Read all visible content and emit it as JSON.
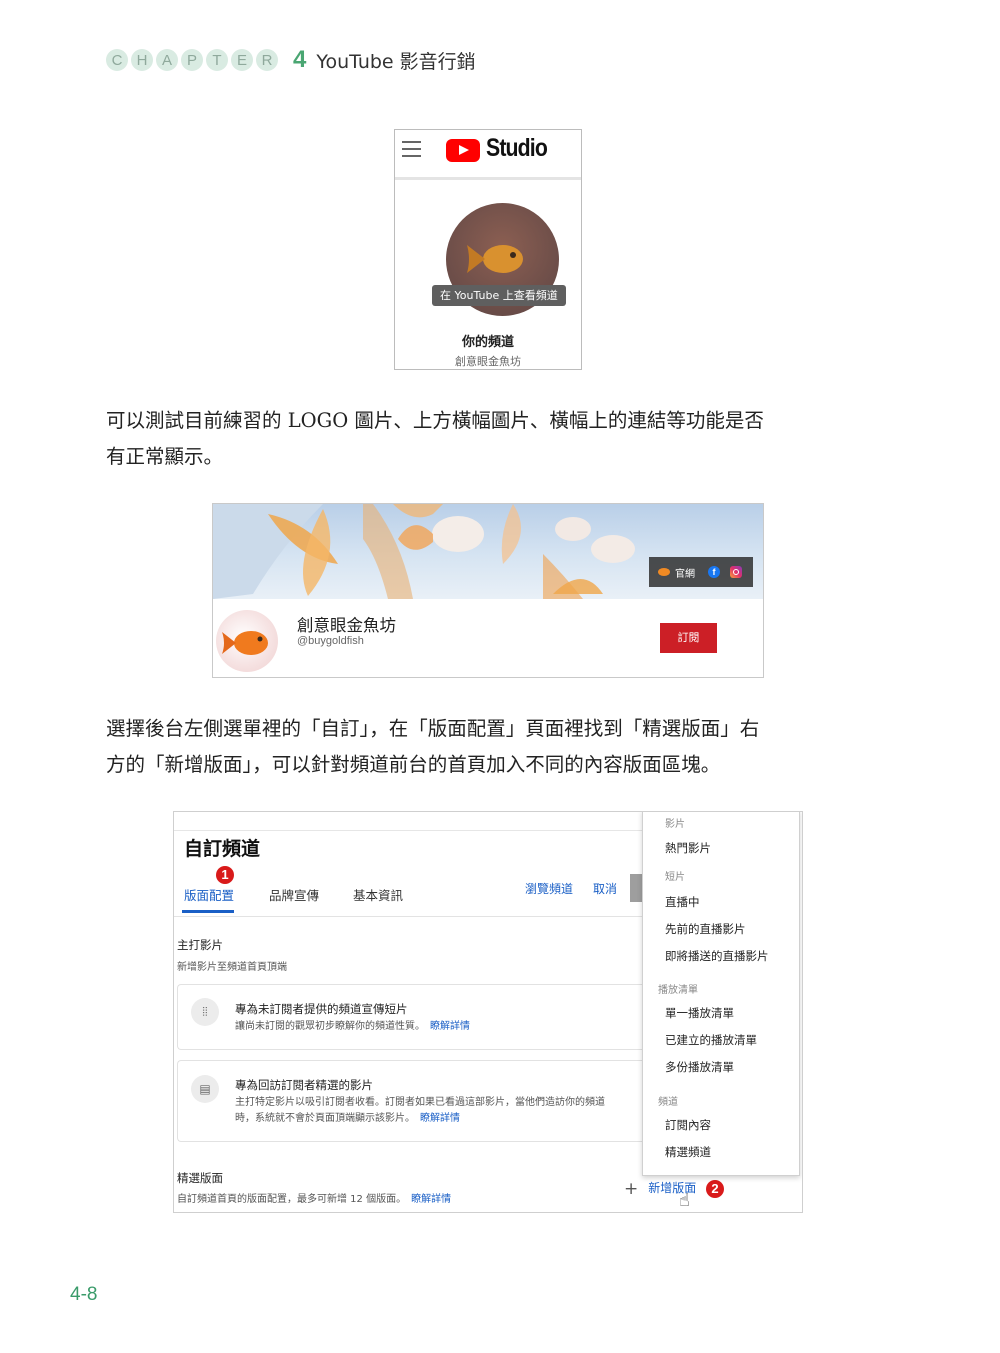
{
  "header": {
    "chapter_letters": [
      "C",
      "H",
      "A",
      "P",
      "T",
      "E",
      "R"
    ],
    "chapter_number": "4",
    "chapter_title": "YouTube 影音行銷"
  },
  "figure1": {
    "app_name": "Studio",
    "tooltip": "在 YouTube 上查看頻道",
    "channel_label": "你的頻道",
    "channel_name": "創意眼金魚坊"
  },
  "paragraphs": {
    "p1_line1": "可以測試目前練習的 LOGO 圖片、上方橫幅圖片、橫幅上的連結等功能是否",
    "p1_line2": "有正常顯示。",
    "p2_line1": "選擇後台左側選單裡的「自訂」，在「版面配置」頁面裡找到「精選版面」右",
    "p2_line2": "方的「新增版面」，可以針對頻道前台的首頁加入不同的內容版面區塊。"
  },
  "figure2": {
    "banner_link_label": "官網",
    "channel_name": "創意眼金魚坊",
    "channel_handle": "@buygoldfish",
    "subscribe_label": "訂閱"
  },
  "figure3": {
    "page_title": "自訂頻道",
    "badge1": "1",
    "badge2": "2",
    "tabs": [
      "版面配置",
      "品牌宣傳",
      "基本資訊"
    ],
    "view_channel": "瀏覽頻道",
    "cancel": "取消",
    "featured_video": {
      "title": "主打影片",
      "desc": "新增影片至頻道首頁頂端"
    },
    "card1": {
      "title": "專為未訂閱者提供的頻道宣傳短片",
      "desc": "讓尚未訂閱的觀眾初步瞭解你的頻道性質。",
      "link": "瞭解詳情"
    },
    "card2": {
      "title": "專為回訪訂閱者精選的影片",
      "desc_line1": "主打特定影片以吸引訂閱者收看。訂閱者如果已看過這部影片，當他們造訪你的頻道",
      "desc_line2": "時，系統就不會於頁面頂端顯示該影片。",
      "link": "瞭解詳情"
    },
    "featured_sections": {
      "title": "精選版面",
      "desc": "自訂頻道首頁的版面配置，最多可新增 12 個版面。",
      "link": "瞭解詳情"
    },
    "add_section": "新增版面",
    "menu": {
      "group_videos": "影片",
      "popular_videos": "熱門影片",
      "group_shorts": "短片",
      "live_now": "直播中",
      "past_live": "先前的直播影片",
      "upcoming_live": "即將播送的直播影片",
      "group_playlists": "播放清單",
      "single_playlist": "單一播放清單",
      "created_playlists": "已建立的播放清單",
      "multiple_playlists": "多份播放清單",
      "group_channels": "頻道",
      "subscriptions": "訂閱內容",
      "featured_channels": "精選頻道"
    }
  },
  "page_number": "4-8"
}
